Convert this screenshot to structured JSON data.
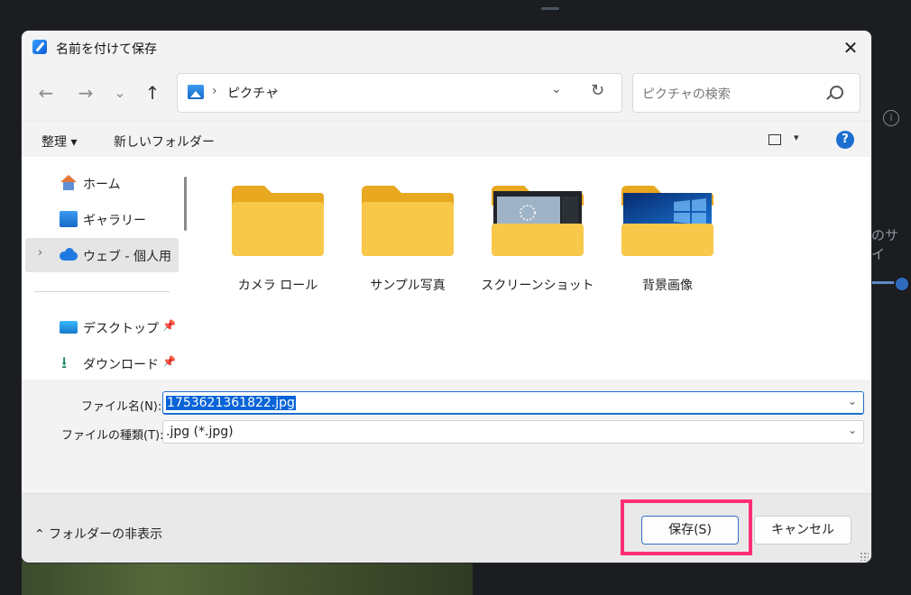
{
  "window": {
    "title": "名前を付けて保存",
    "close": "✕"
  },
  "nav": {
    "back": "←",
    "forward": "→",
    "recent": "⌄",
    "up": "↑",
    "address_sep": "›",
    "address_folder": "ピクチャ",
    "address_dropdown": "⌄",
    "refresh": "↻",
    "search_placeholder": "ピクチャの検索"
  },
  "toolbar": {
    "organize": "整理 ▾",
    "new_folder": "新しいフォルダー",
    "view_dropdown": "▾",
    "help": "?"
  },
  "sidebar": {
    "items": [
      {
        "label": "ホーム",
        "icon": "home-icon"
      },
      {
        "label": "ギャラリー",
        "icon": "gallery-icon"
      },
      {
        "label": "ウェブ - 個人用",
        "icon": "onedrive-cloud-icon",
        "expander": "›",
        "selected": true
      },
      {
        "label": "デスクトップ",
        "icon": "desktop-icon",
        "pin": "📌"
      },
      {
        "label": "ダウンロード",
        "icon": "download-icon",
        "pin": "📌",
        "glyph": "⭳"
      }
    ]
  },
  "folders": [
    {
      "name": "カメラ ロール",
      "thumb": "plain"
    },
    {
      "name": "サンプル写真",
      "thumb": "plain"
    },
    {
      "name": "スクリーンショット",
      "thumb": "screenshot"
    },
    {
      "name": "背景画像",
      "thumb": "wallpaper"
    }
  ],
  "form": {
    "filename_label": "ファイル名(N):",
    "filename_value": "1753621361822.jpg",
    "filetype_label": "ファイルの種類(T):",
    "filetype_value": ".jpg (*.jpg)",
    "dropdown": "⌄"
  },
  "footer": {
    "hide_folders": "⌃ フォルダーの非表示",
    "save": "保存(S)",
    "cancel": "キャンセル"
  },
  "background": {
    "info": "i",
    "text": "のサイ"
  },
  "colors": {
    "accent": "#0a64d8",
    "highlight": "#ff2e77",
    "folder": "#f8c84a"
  }
}
